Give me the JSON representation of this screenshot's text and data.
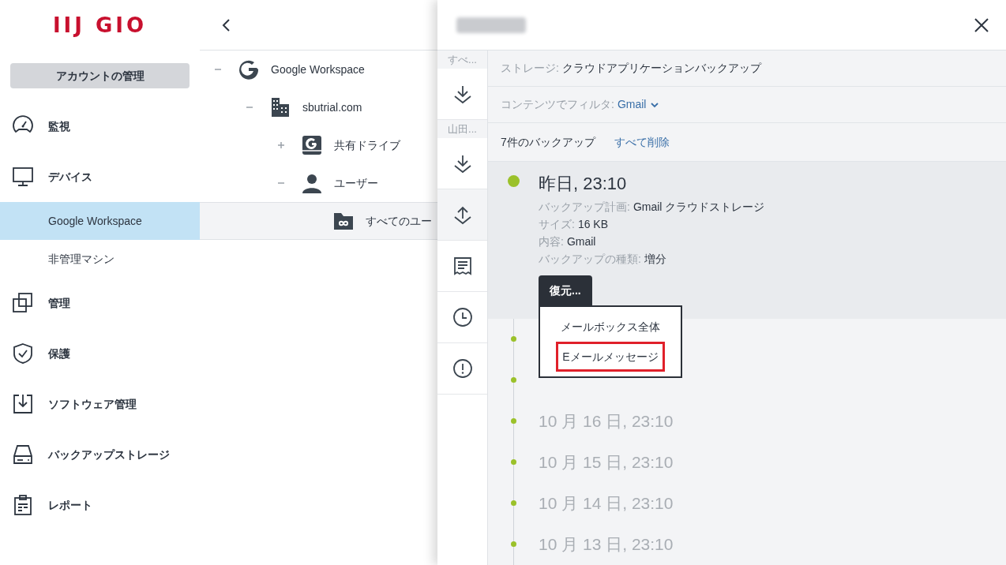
{
  "logo": "IIJ GIO",
  "account_button": "アカウントの管理",
  "nav": [
    {
      "label": "監視",
      "kind": "section",
      "selected": false
    },
    {
      "label": "デバイス",
      "kind": "section",
      "selected": false
    },
    {
      "label": "Google Workspace",
      "kind": "sub",
      "selected": true
    },
    {
      "label": "非管理マシン",
      "kind": "sub",
      "selected": false
    },
    {
      "label": "管理",
      "kind": "section",
      "selected": false
    },
    {
      "label": "保護",
      "kind": "section",
      "selected": false
    },
    {
      "label": "ソフトウェア管理",
      "kind": "section",
      "selected": false
    },
    {
      "label": "バックアップストレージ",
      "kind": "section",
      "selected": false
    },
    {
      "label": "レポート",
      "kind": "section",
      "selected": false
    }
  ],
  "tree": [
    {
      "label": "Google Workspace",
      "expanded": true,
      "selected": false,
      "children": [
        {
          "label": "sbutrial.com",
          "expanded": true,
          "selected": false,
          "children": [
            {
              "label": "共有ドライブ",
              "expanded": false,
              "selected": false
            },
            {
              "label": "ユーザー",
              "expanded": true,
              "selected": false,
              "children": [
                {
                  "label": "すべてのユー",
                  "selected": true
                }
              ]
            }
          ]
        }
      ]
    }
  ],
  "panel": {
    "strip": [
      {
        "kind": "label",
        "text": "すべ..."
      },
      {
        "kind": "action",
        "selected": false
      },
      {
        "kind": "label",
        "text": "山田..."
      },
      {
        "kind": "action",
        "selected": false
      },
      {
        "kind": "action",
        "selected": true
      },
      {
        "kind": "action",
        "selected": false
      },
      {
        "kind": "action",
        "selected": false
      },
      {
        "kind": "action",
        "selected": false
      }
    ],
    "storage": {
      "label": "ストレージ:",
      "value": "クラウドアプリケーションバックアップ"
    },
    "filter": {
      "label": "コンテンツでフィルタ:",
      "value": "Gmail"
    },
    "count": "7件のバックアップ",
    "delete_all": "すべて削除",
    "backups": [
      {
        "title": "昨日, 23:10",
        "expanded": true,
        "details": [
          {
            "label": "バックアップ計画:",
            "value": "Gmail クラウドストレージ"
          },
          {
            "label": "サイズ:",
            "value": "16 KB"
          },
          {
            "label": "内容:",
            "value": "Gmail"
          },
          {
            "label": "バックアップの種類:",
            "value": "増分"
          }
        ],
        "restore_button": "復元...",
        "restore_menu": [
          {
            "label": "メールボックス全体",
            "highlighted": false
          },
          {
            "label": "Eメールメッセージ",
            "highlighted": true
          }
        ]
      },
      {
        "expanded": false
      },
      {
        "expanded": false
      },
      {
        "title": "10 月 16 日, 23:10",
        "expanded": false
      },
      {
        "title": "10 月 15 日, 23:10",
        "expanded": false
      },
      {
        "title": "10 月 14 日, 23:10",
        "expanded": false
      },
      {
        "title": "10 月 13 日, 23:10",
        "expanded": false
      }
    ]
  }
}
